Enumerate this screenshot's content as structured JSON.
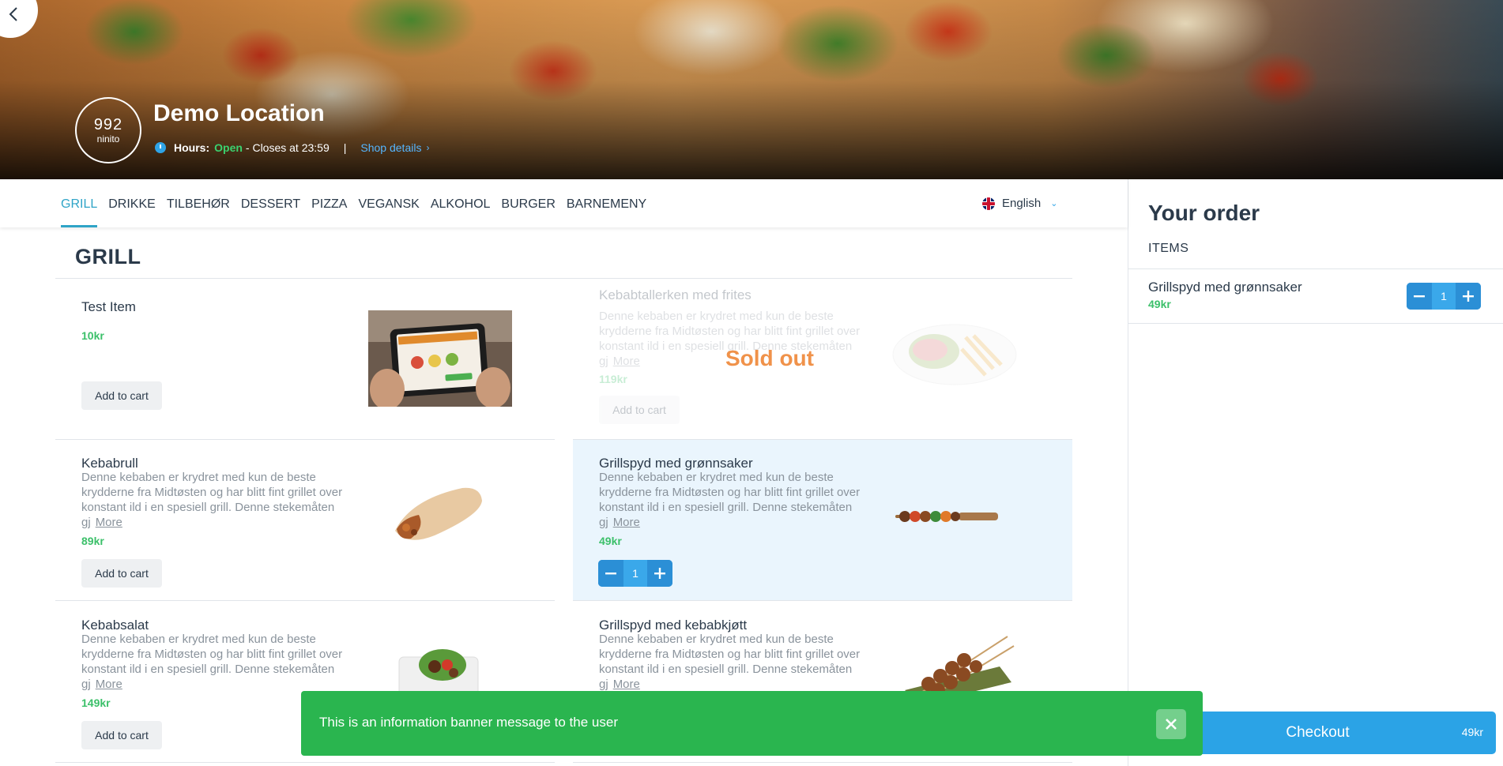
{
  "shop": {
    "logo_line1": "992",
    "logo_line2": "ninito",
    "name": "Demo Location",
    "hours_label": "Hours:",
    "status": "Open",
    "closes": "- Closes at 23:59",
    "separator": "|",
    "details_link": "Shop details"
  },
  "categories": [
    "GRILL",
    "DRIKKE",
    "TILBEHØR",
    "DESSERT",
    "PIZZA",
    "VEGANSK",
    "ALKOHOL",
    "BURGER",
    "BARNEMENY"
  ],
  "language": {
    "selected": "English",
    "flag": "uk-flag-icon"
  },
  "section_title": "GRILL",
  "items": [
    {
      "name": "Test Item",
      "desc": "",
      "more": "",
      "price": "10kr",
      "action": "Add to cart"
    },
    {
      "name": "Kebabtallerken med frites",
      "desc": "Denne kebaben er krydret med kun de beste krydderne fra Midtøsten og har blitt fint grillet over konstant ild i en spesiell grill. Denne stekemåten gj",
      "more": "More",
      "price": "119kr",
      "action": "Add to cart",
      "status": "Sold out"
    },
    {
      "name": "Kebabrull",
      "desc": "Denne kebaben er krydret med kun de beste krydderne fra Midtøsten og har blitt fint grillet over konstant ild i en spesiell grill. Denne stekemåten gj",
      "more": "More",
      "price": "89kr",
      "action": "Add to cart"
    },
    {
      "name": "Grillspyd med grønnsaker",
      "desc": "Denne kebaben er krydret med kun de beste krydderne fra Midtøsten og har blitt fint grillet over konstant ild i en spesiell grill. Denne stekemåten gj",
      "more": "More",
      "price": "49kr",
      "quantity": "1"
    },
    {
      "name": "Kebabsalat",
      "desc": "Denne kebaben er krydret med kun de beste krydderne fra Midtøsten og har blitt fint grillet over konstant ild i en spesiell grill. Denne stekemåten gj",
      "more": "More",
      "price": "149kr",
      "action": "Add to cart"
    },
    {
      "name": "Grillspyd med kebabkjøtt",
      "desc": "Denne kebaben er krydret med kun de beste krydderne fra Midtøsten og har blitt fint grillet over konstant ild i en spesiell grill. Denne stekemåten gj",
      "more": "More",
      "price": "",
      "action": ""
    }
  ],
  "order": {
    "title": "Your order",
    "items_label": "ITEMS",
    "lines": [
      {
        "name": "Grillspyd med grønnsaker",
        "price": "49kr",
        "quantity": "1"
      }
    ],
    "checkout_label": "Checkout",
    "checkout_total": "49kr"
  },
  "banner": {
    "message": "This is an information banner message to the user"
  },
  "colors": {
    "accent": "#2fa4c7",
    "price": "#3cc06a",
    "stepper": "#2b8fd6",
    "checkout": "#2ba3e6",
    "banner": "#2ab54f",
    "sold_out": "#f0924a"
  }
}
